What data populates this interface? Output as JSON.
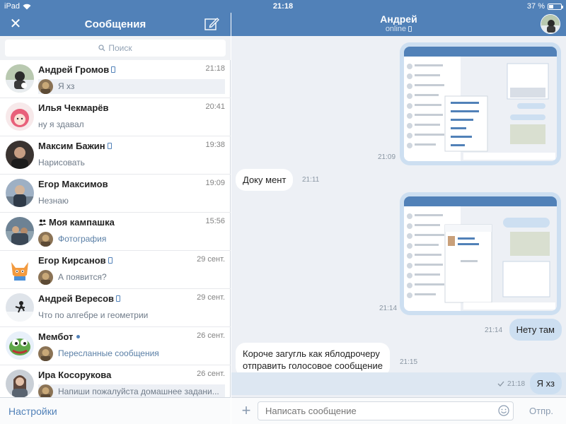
{
  "status_bar": {
    "device": "iPad",
    "time": "21:18",
    "battery": "37 %",
    "battery_level": 0.37
  },
  "left_header": {
    "title": "Сообщения"
  },
  "search": {
    "placeholder": "Поиск"
  },
  "dialogs": [
    {
      "name": "Андрей Громов",
      "time": "21:18",
      "preview": "Я хз",
      "mobile": true
    },
    {
      "name": "Илья Чекмарёв",
      "time": "20:41",
      "preview": "ну я здавал"
    },
    {
      "name": "Максим Бажин",
      "time": "19:38",
      "preview": "Нарисовать",
      "mobile": true
    },
    {
      "name": "Егор Максимов",
      "time": "19:09",
      "preview": "Незнаю"
    },
    {
      "name": "Моя кампашка",
      "time": "15:56",
      "preview": "Фотография",
      "group": true
    },
    {
      "name": "Егор Кирсанов",
      "time": "29 сент.",
      "preview": "А появится?",
      "mobile": true
    },
    {
      "name": "Андрей Вересов",
      "time": "29 сент.",
      "preview": "Что по алгебре и геометрии",
      "mobile": true
    },
    {
      "name": "Мембот",
      "time": "26 сент.",
      "preview": "Пересланные сообщения",
      "online": true
    },
    {
      "name": "Ира Косорукова",
      "time": "26 сент.",
      "preview": "Напиши пожалуйста домашнее задани..."
    }
  ],
  "left_footer": {
    "settings": "Настройки"
  },
  "chat_header": {
    "name": "Андрей",
    "status": "online"
  },
  "messages": [
    {
      "type": "image",
      "time": "21:09"
    },
    {
      "type": "text",
      "text": "Доку мент",
      "time": "21:11"
    },
    {
      "type": "image",
      "time": "21:14"
    },
    {
      "type": "text",
      "text": "Нету там",
      "time": "21:14"
    },
    {
      "type": "text",
      "text_line1": "Короче загугль как яблодрочеру",
      "text_line2": "отправить голосовое сообщение",
      "time": "21:15"
    },
    {
      "type": "text",
      "text": "Я хз",
      "time": "21:18"
    }
  ],
  "composer": {
    "placeholder": "Написать сообщение",
    "send": "Отпр."
  },
  "colors": {
    "header": "#5181b8",
    "background": "#edf0f5",
    "outgoing": "#cddff1",
    "incoming": "#ffffff"
  }
}
